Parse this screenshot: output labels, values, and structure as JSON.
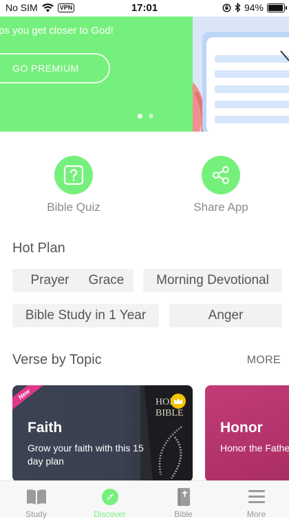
{
  "status_bar": {
    "carrier": "No SIM",
    "vpn": "VPN",
    "time": "17:01",
    "battery": "94%"
  },
  "banner": {
    "tagline": "ps you get closer to God!",
    "cta": "GO PREMIUM",
    "page_index": 0,
    "page_count": 2
  },
  "quick_actions": [
    {
      "label": "Bible Quiz",
      "icon": "question-icon"
    },
    {
      "label": "Share App",
      "icon": "share-icon"
    }
  ],
  "hot_plan": {
    "title": "Hot Plan",
    "chips": [
      "Prayer",
      "Grace",
      "Morning Devotional",
      "Bible Study in 1 Year",
      "Anger"
    ]
  },
  "verse_by_topic": {
    "title": "Verse by Topic",
    "more": "MORE",
    "cards": [
      {
        "title": "Faith",
        "desc_line1": "Grow your faith with this 15",
        "desc_line2": "day plan",
        "badge": "New",
        "image_text1": "HOLY",
        "image_text2": "BIBLE"
      },
      {
        "title": "Honor",
        "desc_line1": "Honor the Fathe"
      }
    ]
  },
  "tabbar": {
    "tabs": [
      {
        "label": "Study",
        "icon": "book-icon"
      },
      {
        "label": "Discover",
        "icon": "compass-icon",
        "active": true
      },
      {
        "label": "Bible",
        "icon": "bible-icon"
      },
      {
        "label": "More",
        "icon": "menu-icon"
      }
    ]
  },
  "colors": {
    "accent": "#76F07C",
    "chip_bg": "#f2f2f2",
    "faith_card": "#3a4050",
    "honor_card": "#b8356f"
  }
}
